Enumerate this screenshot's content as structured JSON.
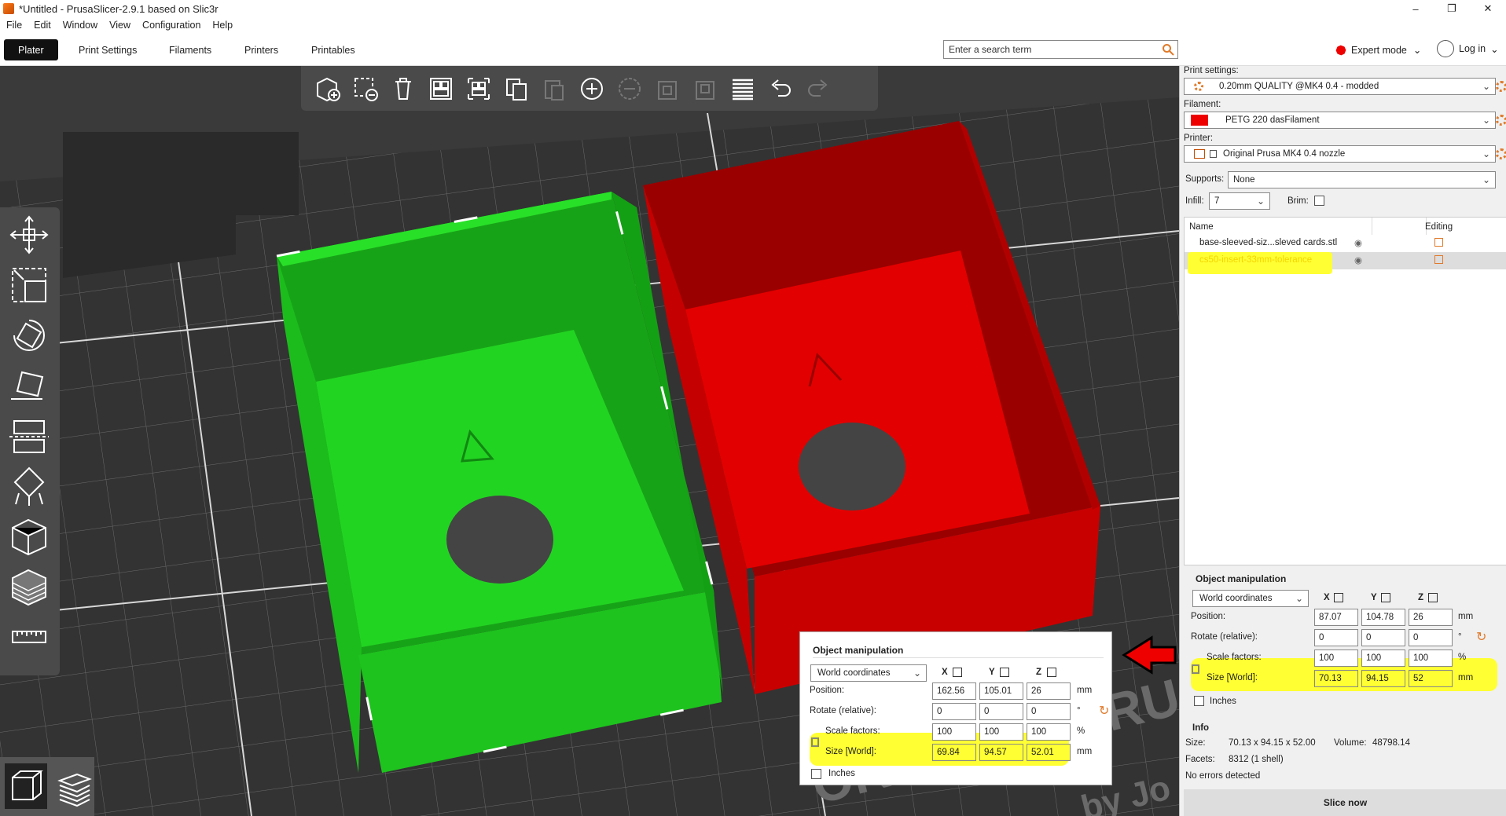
{
  "window": {
    "title": "*Untitled - PrusaSlicer-2.9.1 based on Slic3r",
    "minimize": "–",
    "maximize": "❐",
    "close": "✕"
  },
  "menu": [
    "File",
    "Edit",
    "Window",
    "View",
    "Configuration",
    "Help"
  ],
  "tabs": [
    "Plater",
    "Print Settings",
    "Filaments",
    "Printers",
    "Printables"
  ],
  "search": {
    "placeholder": "Enter a search term"
  },
  "mode": {
    "label": "Expert mode",
    "color": "#e00000"
  },
  "login": {
    "label": "Log in"
  },
  "viewport": {
    "bed_text": "ORIGINAL PRUSA M",
    "bed_text2": "by Jo",
    "objects": [
      {
        "name": "green-box",
        "color": "#22dd22"
      },
      {
        "name": "red-box",
        "color": "#dd0000"
      }
    ]
  },
  "float_manip": {
    "title": "Object manipulation",
    "coord": "World coordinates",
    "axes": [
      "X",
      "Y",
      "Z"
    ],
    "rows": [
      {
        "label": "Position:",
        "values": [
          "162.56",
          "105.01",
          "26"
        ],
        "unit": "mm"
      },
      {
        "label": "Rotate (relative):",
        "values": [
          "0",
          "0",
          "0"
        ],
        "unit": "°"
      },
      {
        "label": "Scale factors:",
        "values": [
          "100",
          "100",
          "100"
        ],
        "unit": "%"
      },
      {
        "label": "Size [World]:",
        "values": [
          "69.84",
          "94.57",
          "52.01"
        ],
        "unit": "mm"
      }
    ],
    "inches": "Inches"
  },
  "sidebar": {
    "print_settings_label": "Print settings:",
    "print_settings_value": "0.20mm QUALITY @MK4 0.4 - modded",
    "filament_label": "Filament:",
    "filament_value": "PETG 220 dasFilament",
    "filament_color": "#ee0000",
    "printer_label": "Printer:",
    "printer_value": "Original Prusa MK4 0.4 nozzle",
    "supports_label": "Supports:",
    "supports_value": "None",
    "infill_label": "Infill:",
    "infill_value": "7",
    "brim_label": "Brim:",
    "list_headers": {
      "name": "Name",
      "editing": "Editing"
    },
    "objects": [
      {
        "name": "base-sleeved-siz...sleved cards.stl"
      },
      {
        "name": "cs50-insert-33mm-tolerance"
      }
    ]
  },
  "manip": {
    "title": "Object manipulation",
    "coord": "World coordinates",
    "axes": [
      "X",
      "Y",
      "Z"
    ],
    "rows": [
      {
        "label": "Position:",
        "values": [
          "87.07",
          "104.78",
          "26"
        ],
        "unit": "mm"
      },
      {
        "label": "Rotate (relative):",
        "values": [
          "0",
          "0",
          "0"
        ],
        "unit": "°"
      },
      {
        "label": "Scale factors:",
        "values": [
          "100",
          "100",
          "100"
        ],
        "unit": "%"
      },
      {
        "label": "Size [World]:",
        "values": [
          "70.13",
          "94.15",
          "52"
        ],
        "unit": "mm"
      }
    ],
    "inches": "Inches"
  },
  "info": {
    "title": "Info",
    "size_label": "Size:",
    "size_value": "70.13 x 94.15 x 52.00",
    "volume_label": "Volume:",
    "volume_value": "48798.14",
    "facets_label": "Facets:",
    "facets_value": "8312 (1 shell)",
    "errors": "No errors detected"
  },
  "slice_button": "Slice now",
  "highlight_color": "#ffff33"
}
